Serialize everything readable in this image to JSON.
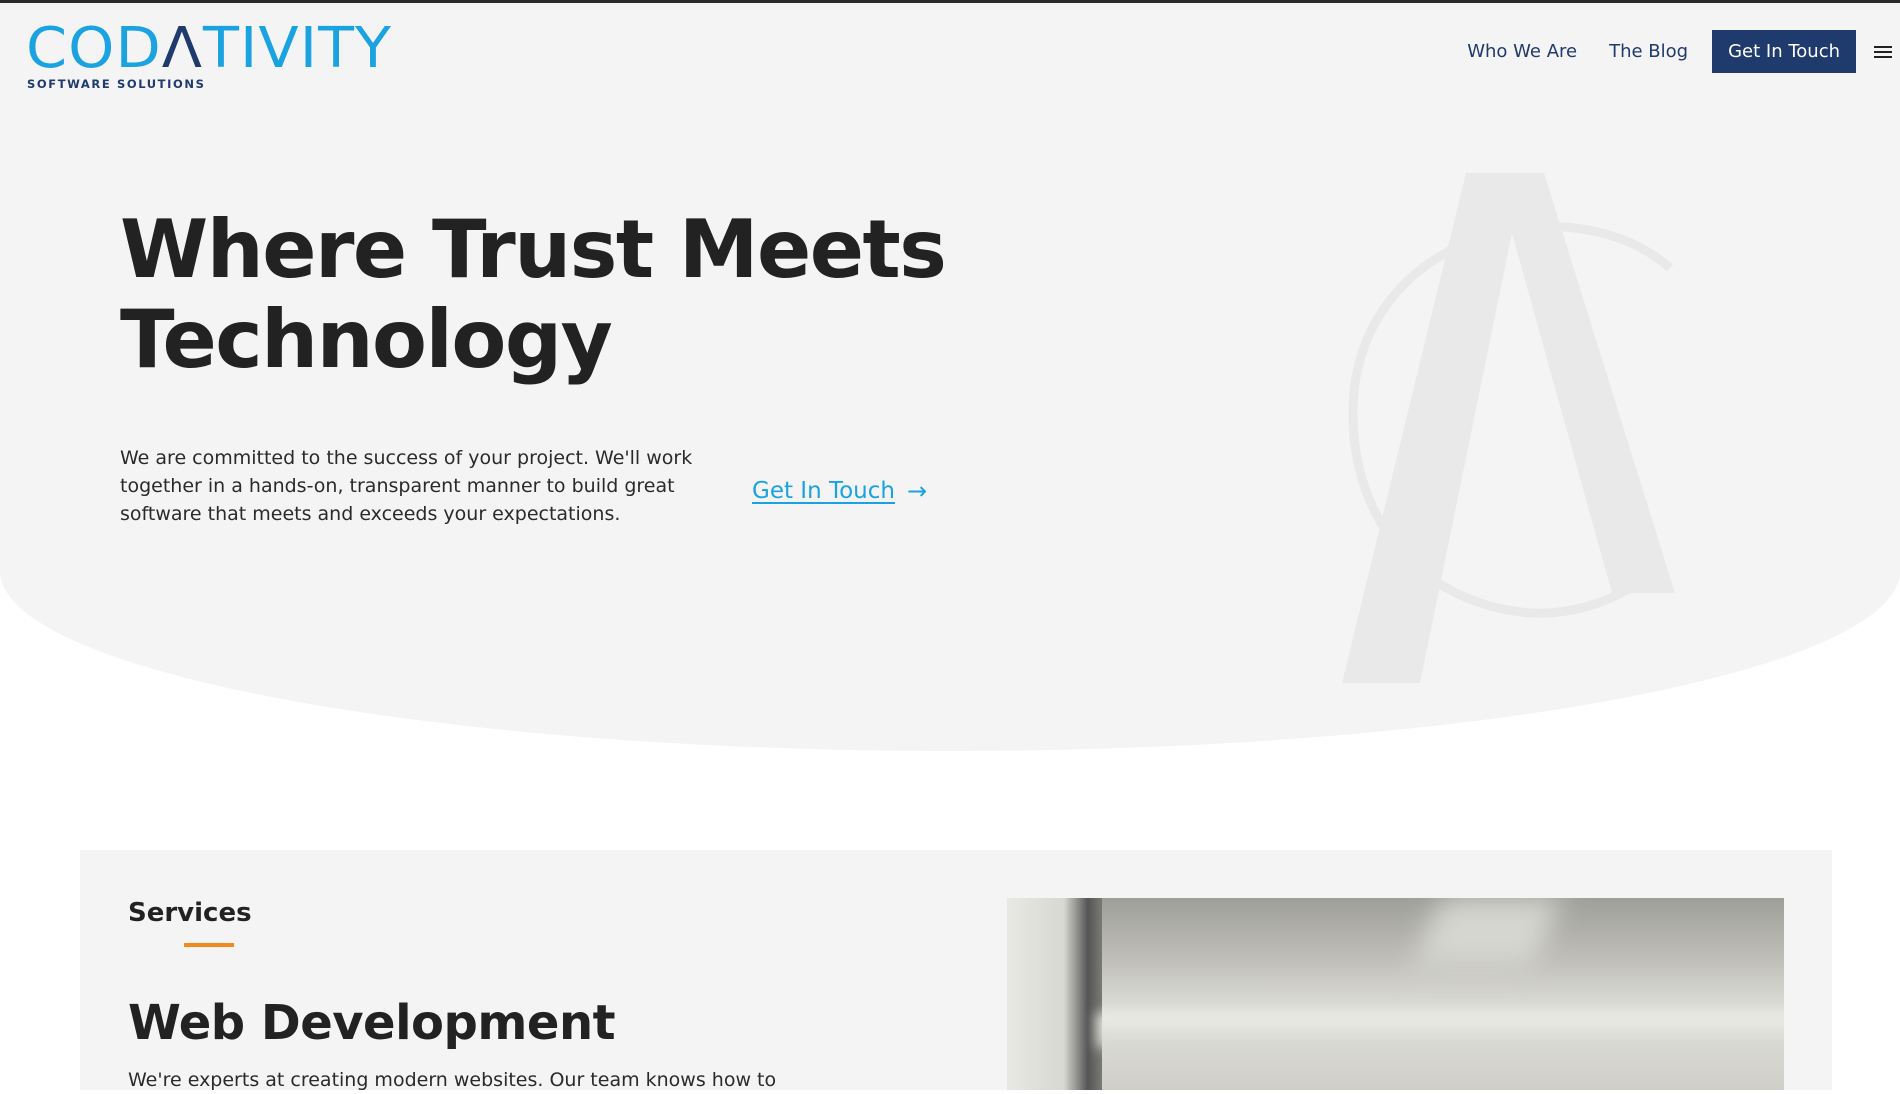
{
  "brand": {
    "name_part1": "COD",
    "name_accent": "Λ",
    "name_part2": "TIVITY",
    "tagline": "SOFTWARE SOLUTIONS",
    "primary_color": "#1aa3e0",
    "navy_color": "#1f3a6c"
  },
  "nav": {
    "items": [
      {
        "label": "Who We Are"
      },
      {
        "label": "The Blog"
      }
    ],
    "cta_label": "Get In Touch",
    "menu_icon": "hamburger-icon"
  },
  "hero": {
    "title_line1": "Where Trust Meets",
    "title_line2": "Technology",
    "description": "We are committed to the success of your project. We'll work together in a hands-on, transparent manner to build great software that meets and exceeds your expectations.",
    "link_label": "Get In Touch",
    "link_arrow": "→",
    "watermark_icon": "brand-a-logo-icon"
  },
  "services": {
    "label": "Services",
    "accent_color": "#f08a1c",
    "title": "Web Development",
    "description": "We're experts at creating modern websites. Our team knows how to"
  }
}
